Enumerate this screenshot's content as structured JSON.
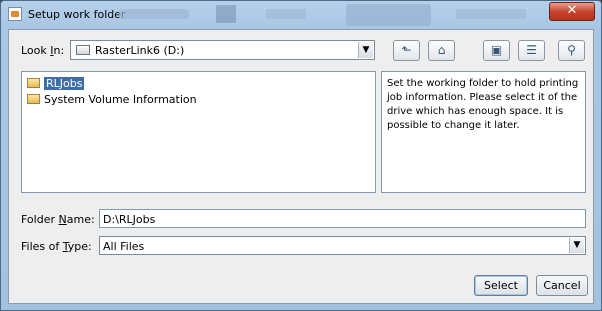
{
  "window": {
    "title": "Setup work folder",
    "close_glyph": "✕"
  },
  "lookin": {
    "label_prefix": "Look ",
    "label_mnemonic": "I",
    "label_suffix": "n:",
    "value": "RasterLink6 (D:)"
  },
  "toolbar": {
    "buttons": [
      {
        "name": "up-one-level-icon",
        "glyph": "⬑"
      },
      {
        "name": "home-icon",
        "glyph": "⌂"
      },
      {
        "name": "new-folder-icon",
        "glyph": "▣"
      },
      {
        "name": "list-view-icon",
        "glyph": "☰"
      },
      {
        "name": "details-view-icon",
        "glyph": "⚲"
      }
    ]
  },
  "files": [
    {
      "name": "RLJobs",
      "selected": true
    },
    {
      "name": "System Volume Information",
      "selected": false
    }
  ],
  "description": "Set the working folder to hold printing job information. Please select it of the drive which has enough space. It is possible to change it later.",
  "folder_name": {
    "label_prefix": "Folder ",
    "label_mnemonic": "N",
    "label_suffix": "ame:",
    "value": "D:\\RLJobs"
  },
  "files_of_type": {
    "label_prefix": "Files of ",
    "label_mnemonic": "T",
    "label_suffix": "ype:",
    "value": "All Files"
  },
  "buttons": {
    "select": "Select",
    "cancel": "Cancel"
  }
}
